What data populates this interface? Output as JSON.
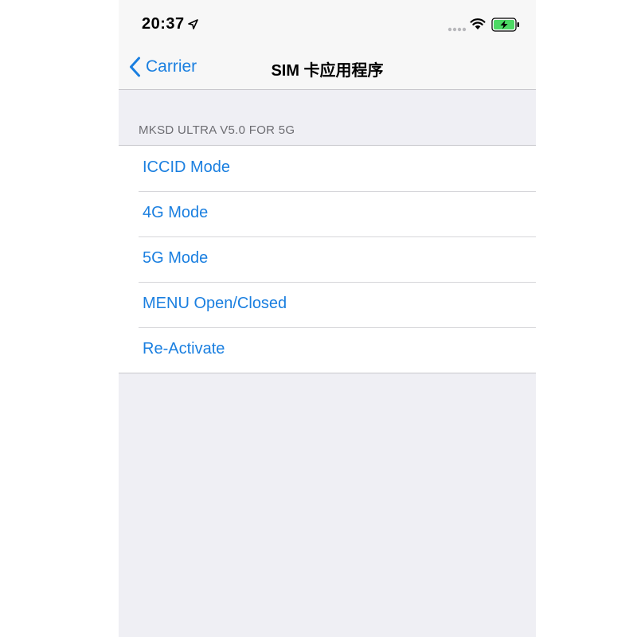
{
  "status_bar": {
    "time": "20:37",
    "icons": [
      "location-arrow-icon",
      "cellular-signal-icon",
      "wifi-icon",
      "battery-charging-icon"
    ],
    "battery_color": "#4cd964"
  },
  "nav": {
    "back_label": "Carrier",
    "title": "SIM 卡应用程序"
  },
  "section": {
    "header": "MKSD ULTRA V5.0 FOR 5G"
  },
  "menu_items": [
    {
      "label": "ICCID Mode"
    },
    {
      "label": "4G Mode"
    },
    {
      "label": "5G Mode"
    },
    {
      "label": "MENU Open/Closed"
    },
    {
      "label": "Re-Activate"
    }
  ],
  "colors": {
    "accent": "#1a7fe0",
    "background": "#efeff4",
    "bar": "#f7f7f7"
  }
}
